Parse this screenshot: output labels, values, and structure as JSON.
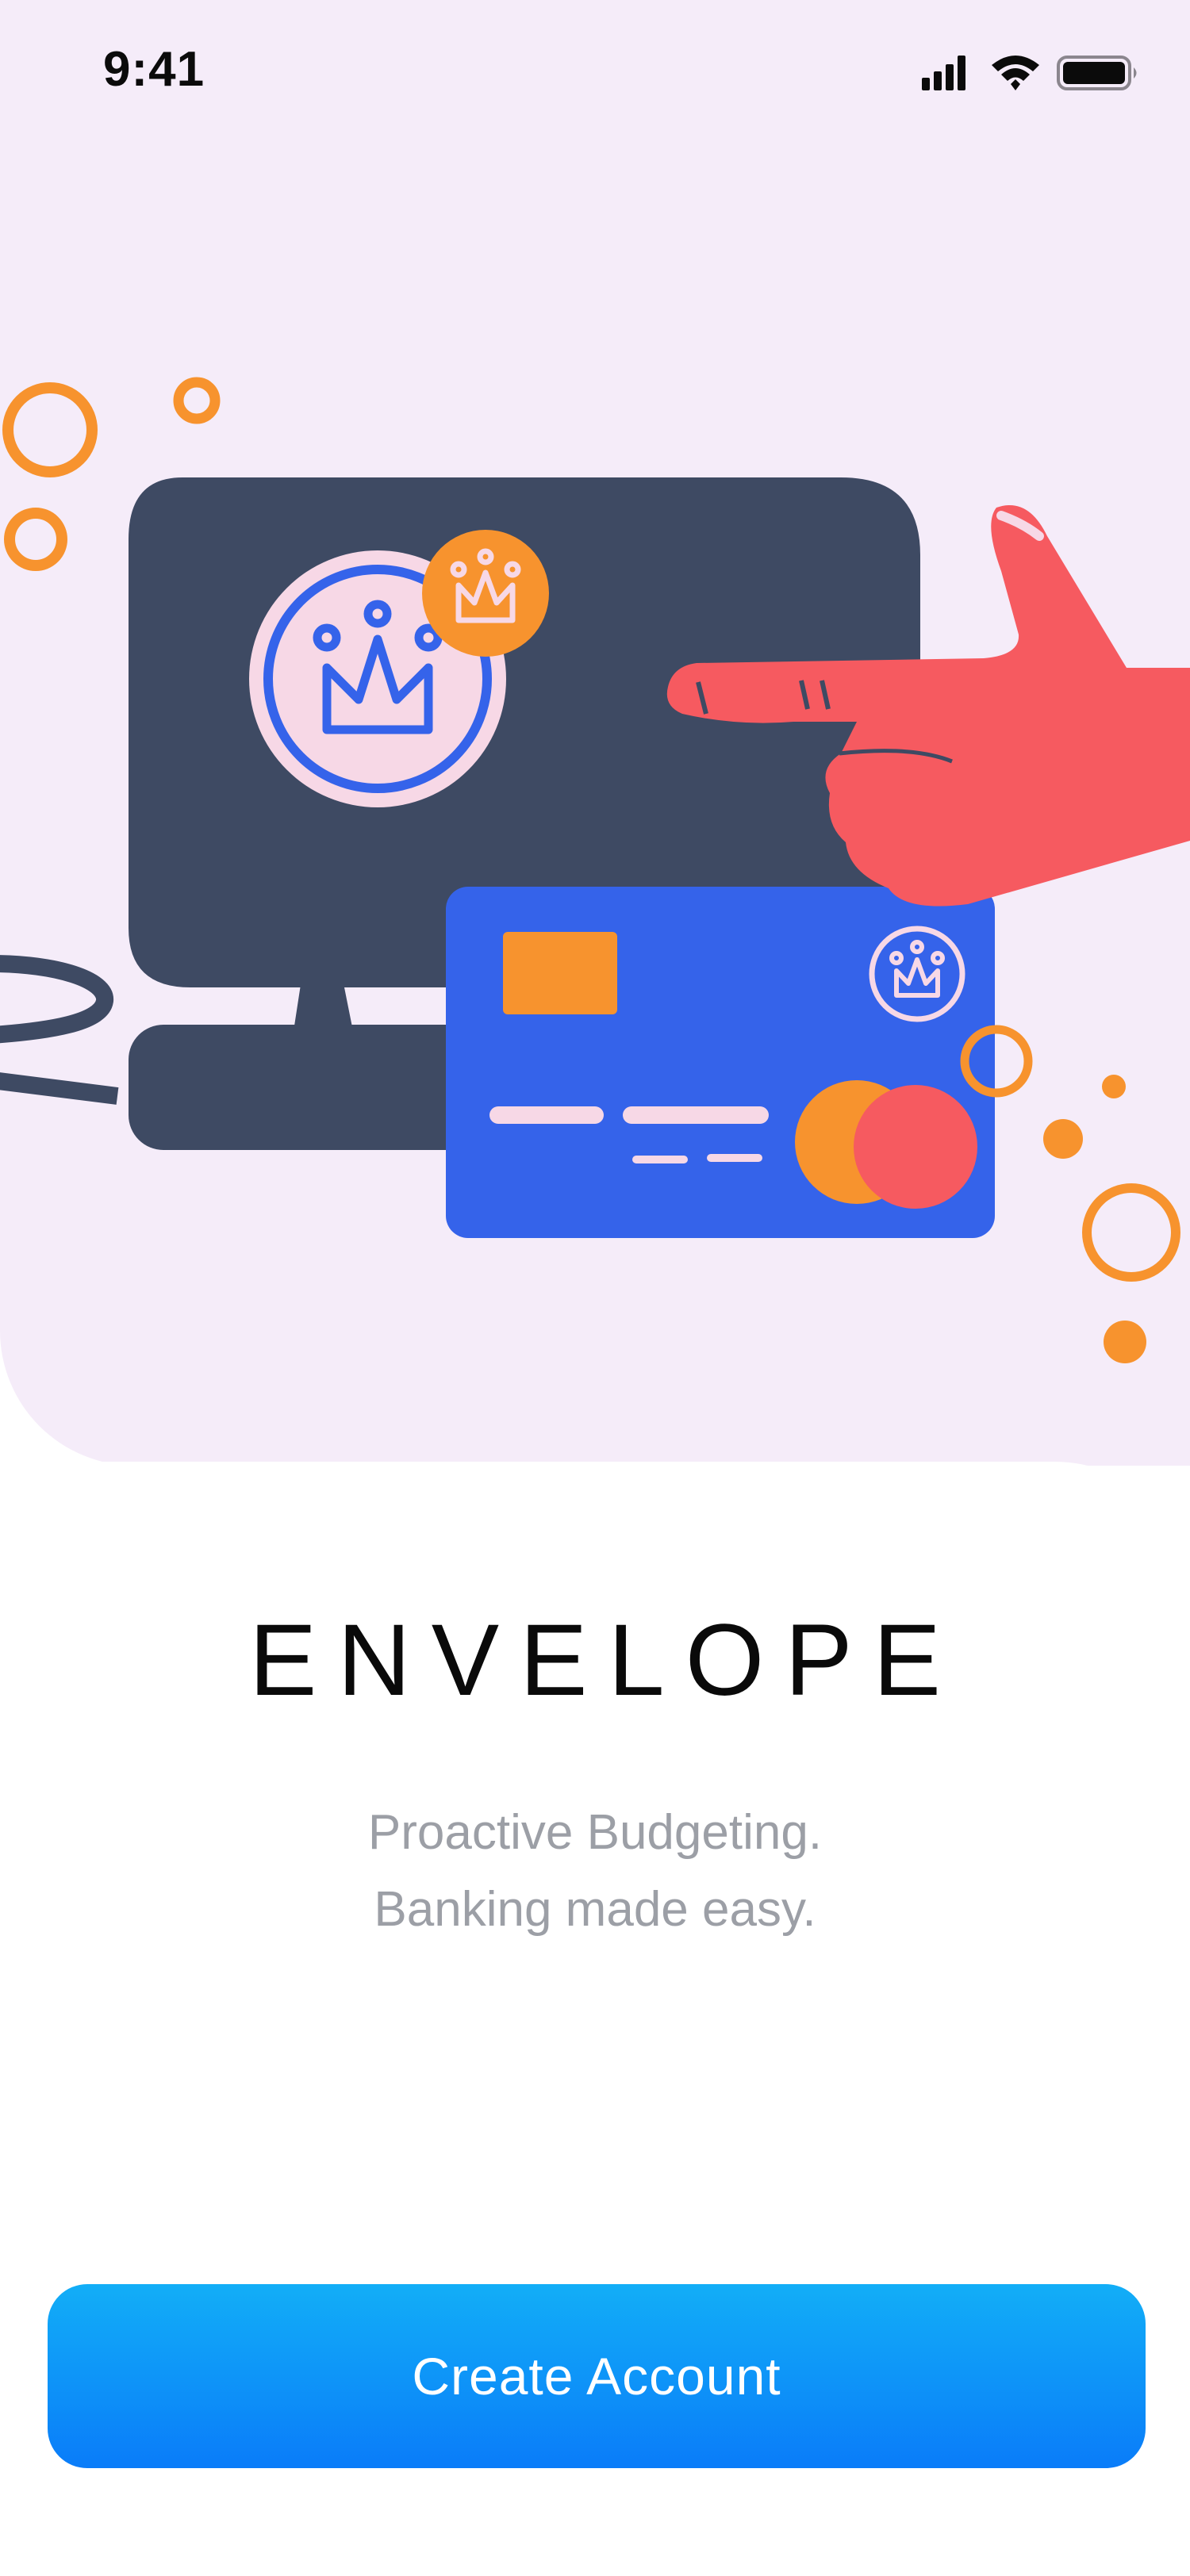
{
  "status_bar": {
    "time": "9:41",
    "icons": [
      "signal-icon",
      "wifi-icon",
      "battery-icon"
    ]
  },
  "hero": {
    "illustration": "monitor-card-hand-illustration",
    "background_color": "#F5ECF9"
  },
  "branding": {
    "title": "ENVELOPE",
    "tagline_line1": "Proactive Budgeting.",
    "tagline_line2": "Banking made easy."
  },
  "actions": {
    "create_account_label": "Create Account"
  },
  "colors": {
    "accent_blue": "#0A7CF9",
    "orange": "#F7932E",
    "monitor_navy": "#3E4A63",
    "card_blue": "#3563EA",
    "hand_red": "#F65A60",
    "tagline_gray": "#9C9FA6"
  }
}
